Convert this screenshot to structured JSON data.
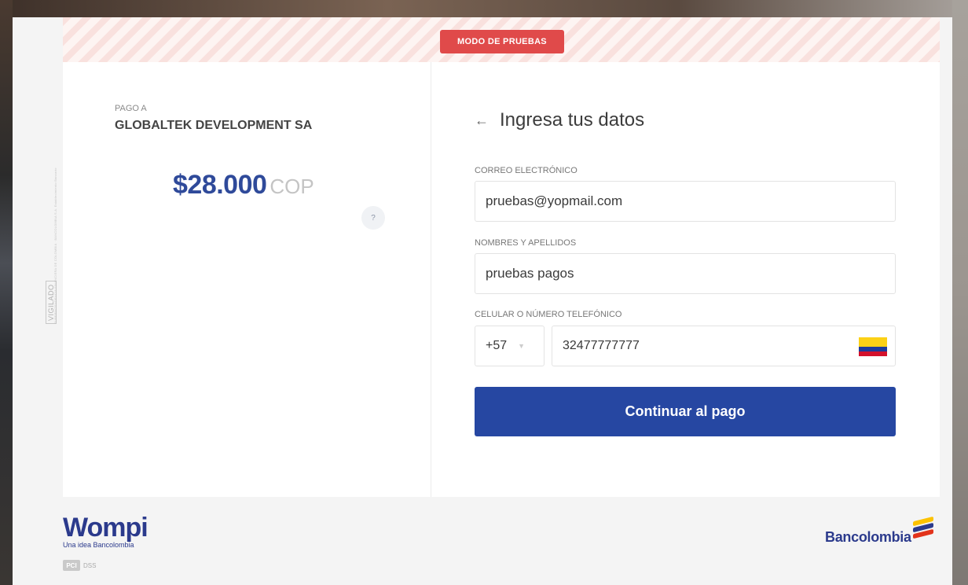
{
  "side_seal": {
    "vigilado": "VIGILADO",
    "regulator": "SUPERINTENDENCIA FINANCIERA DE COLOMBIA · BANCOLOMBIA S.A. Establecimiento Bancario"
  },
  "banner": {
    "test_mode": "MODO DE PRUEBAS"
  },
  "summary": {
    "pay_to_label": "PAGO A",
    "merchant": "GLOBALTEK DEVELOPMENT SA",
    "amount": "$28.000",
    "currency": "COP",
    "help_label": "?"
  },
  "form": {
    "back_icon": "←",
    "title": "Ingresa tus datos",
    "email_label": "CORREO ELECTRÓNICO",
    "email_value": "pruebas@yopmail.com",
    "name_label": "NOMBRES Y APELLIDOS",
    "name_value": "pruebas pagos",
    "phone_label": "CELULAR O NÚMERO TELEFÓNICO",
    "country_code": "+57",
    "country_chevron": "▼",
    "phone_value": "32477777777",
    "continue_label": "Continuar al pago"
  },
  "footer": {
    "wompi_logo": "Wompi",
    "wompi_tagline": "Una idea Bancolombia",
    "pci_badge": "PCI",
    "pci_text": "DSS",
    "bank_logo": "Bancolombia"
  },
  "colors": {
    "primary": "#2647a2",
    "test_badge": "#e04a4a",
    "amount": "#2f4a9a"
  }
}
